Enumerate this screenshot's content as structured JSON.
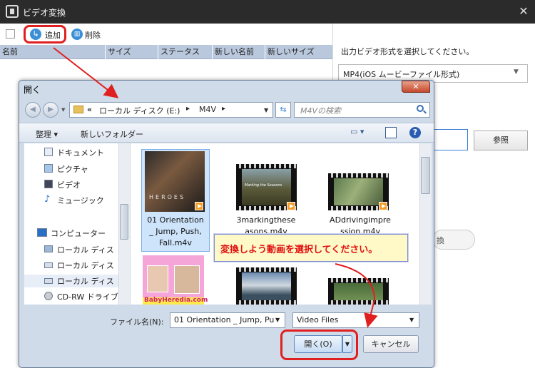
{
  "app": {
    "title": "ビデオ変換",
    "close_glyph": "✕"
  },
  "toolbar": {
    "add_label": "追加",
    "delete_label": "削除"
  },
  "file_table": {
    "columns": [
      "名前",
      "サイズ",
      "ステータス",
      "新しい名前",
      "新しいサイズ"
    ]
  },
  "right_panel": {
    "format_label": "出力ビデオ形式を選択してください。",
    "format_value": "MP4(iOS ムービーファイル形式)",
    "browse_label": "参照",
    "partial_text": "換"
  },
  "dialog": {
    "title": "開く",
    "address": {
      "prefix": "«",
      "drive": "ローカル ディスク (E:)",
      "separator": "▸",
      "folder": "M4V"
    },
    "search_placeholder": "M4Vの検索",
    "organize_label": "整理 ▾",
    "new_folder_label": "新しいフォルダー",
    "nav_items": [
      {
        "label": "ドキュメント"
      },
      {
        "label": "ピクチャ"
      },
      {
        "label": "ビデオ"
      },
      {
        "label": "ミュージック"
      },
      {
        "label": "コンピューター"
      },
      {
        "label": "ローカル ディス"
      },
      {
        "label": "ローカル ディス"
      },
      {
        "label": "ローカル ディス"
      },
      {
        "label": "CD-RW ドライブ"
      }
    ],
    "files": [
      {
        "name_lines": [
          "01 Orientation",
          "_ Jump, Push,",
          "Fall.m4v"
        ],
        "thumb_text": "HEROES"
      },
      {
        "name_lines": [
          "3markingthese",
          "asons.m4v"
        ],
        "thumb_text": "Marking the Seasons"
      },
      {
        "name_lines": [
          "ADdrivingimpre",
          "ssion.m4v"
        ],
        "thumb_text": ""
      },
      {
        "name_lines": [],
        "thumb_text": "BabyHeredia.com"
      },
      {
        "name_lines": [],
        "thumb_text": ""
      },
      {
        "name_lines": [],
        "thumb_text": ""
      }
    ],
    "filename_label": "ファイル名(N):",
    "filename_value": "01 Orientation _ Jump, Pu",
    "filetype_value": "Video Files",
    "open_label": "開く(O)",
    "cancel_label": "キャンセル"
  },
  "callout": {
    "text": "変換しよう動画を選択してください。"
  },
  "colors": {
    "highlight_red": "#e02020",
    "callout_text": "#e01010",
    "callout_bg": "#fff9c8"
  }
}
